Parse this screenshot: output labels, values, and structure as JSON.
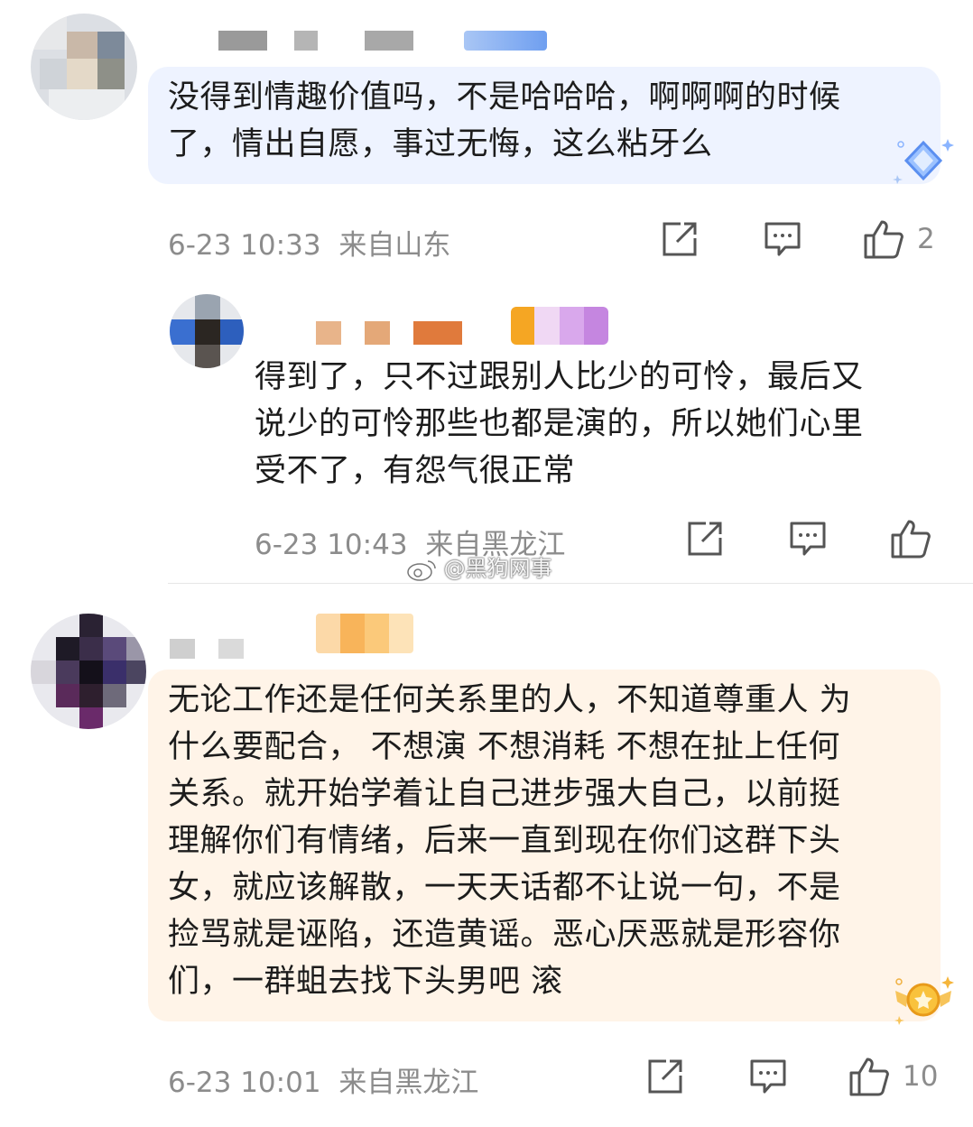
{
  "comments": [
    {
      "text": "没得到情趣价值吗，不是哈哈哈，啊啊啊的时候\n了，情出自愿，事过无悔，这么粘牙么",
      "time": "6-23 10:33",
      "location": "来自山东",
      "like_count": "2"
    },
    {
      "text": "得到了，只不过跟别人比少的可怜，最后又\n说少的可怜那些也都是演的，所以她们心里\n受不了，有怨气很正常",
      "time": "6-23 10:43",
      "location": "来自黑龙江",
      "like_count": ""
    },
    {
      "text": "无论工作还是任何关系里的人，不知道尊重人 为\n什么要配合， 不想演  不想消耗 不想在扯上任何\n关系。就开始学着让自己进步强大自己，以前挺\n理解你们有情绪，后来一直到现在你们这群下头\n女，就应该解散，一天天话都不让说一句，不是\n捡骂就是诬陷，还造黄谣。恶心厌恶就是形容你\n们，一群蛆去找下头男吧 滚",
      "time": "6-23 10:01",
      "location": "来自黑龙江",
      "like_count": "10"
    }
  ],
  "watermark": "@黑狗网事",
  "icons": {
    "share": "share-icon",
    "comment": "comment-icon",
    "like": "thumbs-up-icon"
  },
  "colors": {
    "meta_text": "#8c8c8c",
    "bubble_blue": "#eef3ff",
    "bubble_orange": "#fff4e8"
  }
}
